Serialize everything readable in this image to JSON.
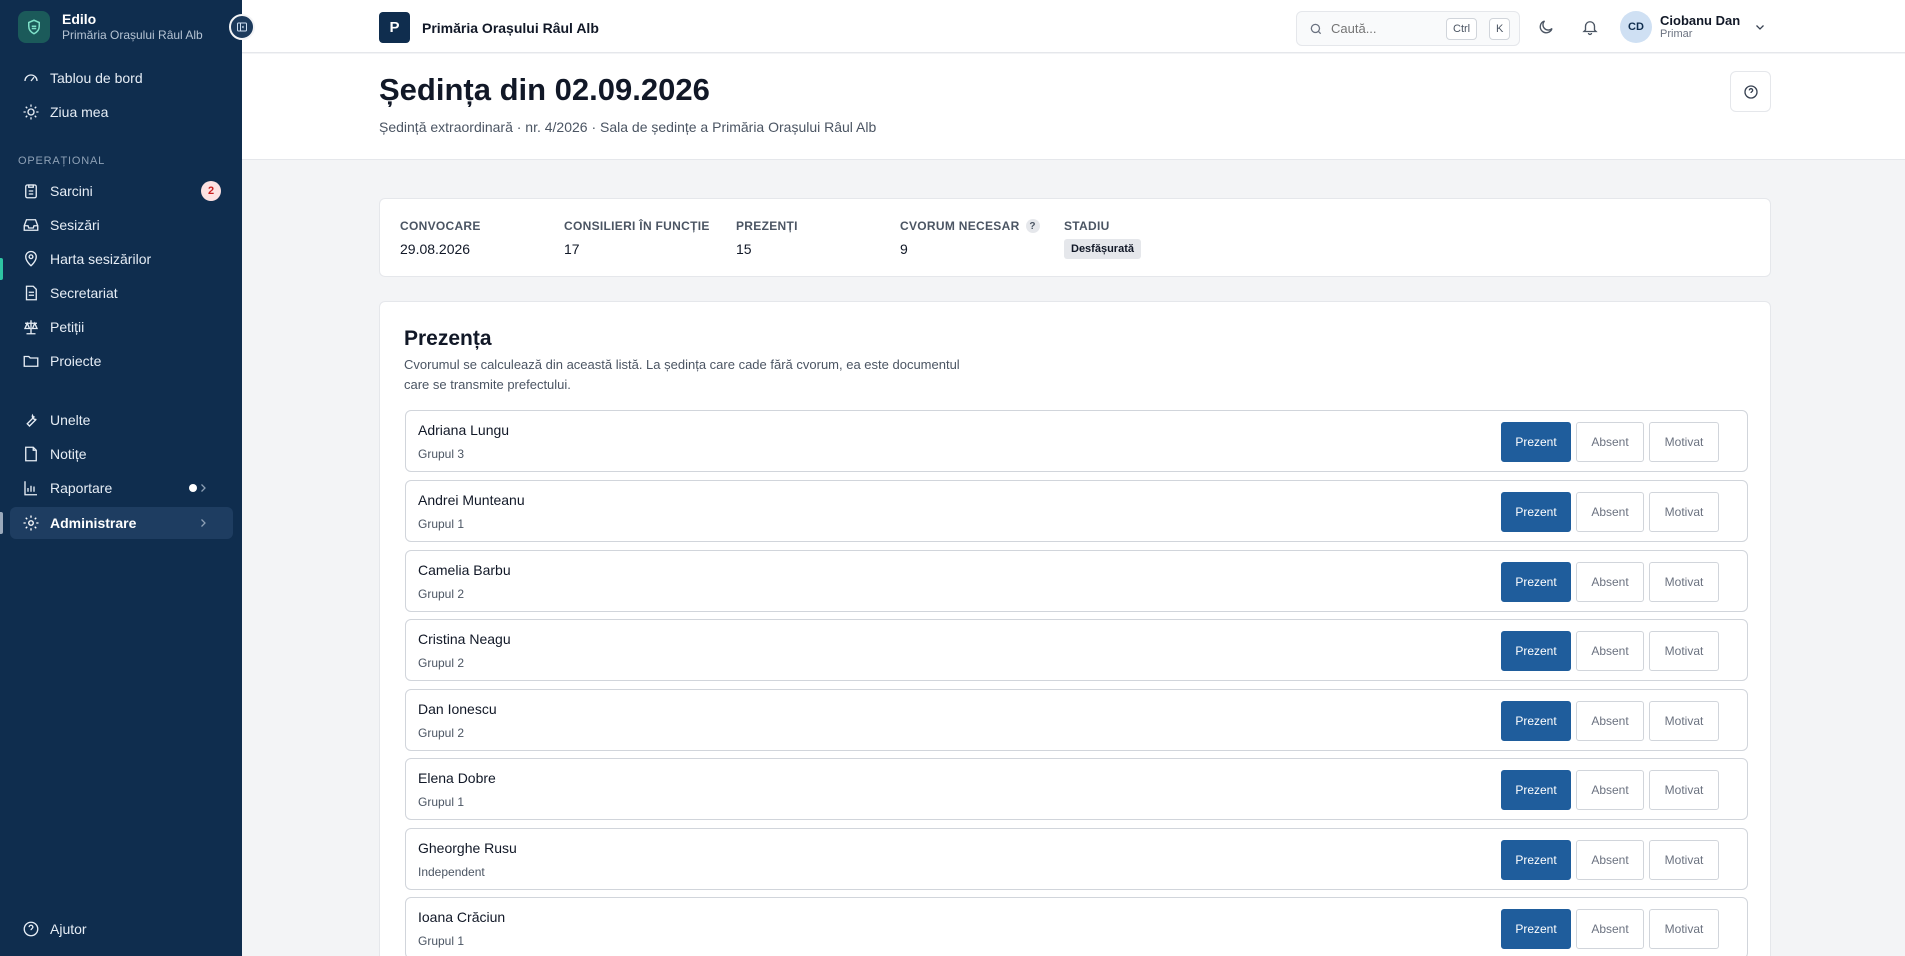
{
  "brand": {
    "name": "Edilo",
    "subtitle": "Primăria Orașului Râul Alb"
  },
  "sidebar": {
    "top_items": [
      {
        "label": "Tablou de bord",
        "icon": "gauge-icon"
      },
      {
        "label": "Ziua mea",
        "icon": "sun-icon"
      }
    ],
    "section_label": "OPERAȚIONAL",
    "ops_items": [
      {
        "label": "Sarcini",
        "icon": "clipboard-icon",
        "badge": "2"
      },
      {
        "label": "Sesizări",
        "icon": "inbox-icon"
      },
      {
        "label": "Harta sesizărilor",
        "icon": "map-pin-icon"
      },
      {
        "label": "Secretariat",
        "icon": "document-icon"
      },
      {
        "label": "Petiții",
        "icon": "scale-icon"
      },
      {
        "label": "Proiecte",
        "icon": "folder-icon"
      }
    ],
    "tool_items": [
      {
        "label": "Unelte",
        "icon": "wrench-icon"
      },
      {
        "label": "Notițe",
        "icon": "note-icon"
      },
      {
        "label": "Raportare",
        "icon": "chart-icon"
      },
      {
        "label": "Administrare",
        "icon": "gear-icon"
      }
    ],
    "help_label": "Ajutor"
  },
  "topbar": {
    "org_initial": "P",
    "org_name": "Primăria Orașului Râul Alb",
    "search_placeholder": "Caută...",
    "kbd_ctrl": "Ctrl",
    "kbd_k": "K",
    "user": {
      "initials": "CD",
      "name": "Ciobanu Dan",
      "role": "Primar"
    }
  },
  "header": {
    "title": "Ședința din 02.09.2026",
    "subtitle": "Ședință extraordinară · nr. 4/2026 · Sala de ședințe a Primăria Orașului Râul Alb"
  },
  "stats": [
    {
      "label": "CONVOCARE",
      "value": "29.08.2026"
    },
    {
      "label": "CONSILIERI ÎN FUNCȚIE",
      "value": "17"
    },
    {
      "label": "PREZENȚI",
      "value": "15"
    },
    {
      "label": "CVORUM NECESAR",
      "value": "9",
      "help": "?"
    },
    {
      "label": "STADIU",
      "value": "Desfășurată"
    }
  ],
  "attendance": {
    "title": "Prezența",
    "description": "Cvorumul se calculează din această listă. La ședința care cade fără cvorum, ea este documentul care se transmite prefectului.",
    "options": {
      "present": "Prezent",
      "absent": "Absent",
      "excused": "Motivat"
    },
    "members": [
      {
        "name": "Adriana Lungu",
        "group": "Grupul 3",
        "status": "present"
      },
      {
        "name": "Andrei Munteanu",
        "group": "Grupul 1",
        "status": "present"
      },
      {
        "name": "Camelia Barbu",
        "group": "Grupul 2",
        "status": "present"
      },
      {
        "name": "Cristina Neagu",
        "group": "Grupul 2",
        "status": "present"
      },
      {
        "name": "Dan Ionescu",
        "group": "Grupul 2",
        "status": "present"
      },
      {
        "name": "Elena Dobre",
        "group": "Grupul 1",
        "status": "present"
      },
      {
        "name": "Gheorghe Rusu",
        "group": "Independent",
        "status": "present"
      },
      {
        "name": "Ioana Crăciun",
        "group": "Grupul 1",
        "status": "present"
      }
    ]
  },
  "colors": {
    "sidebar_bg": "#0f2d4e",
    "primary": "#1f5d9c",
    "accent": "#2ec4a3"
  }
}
